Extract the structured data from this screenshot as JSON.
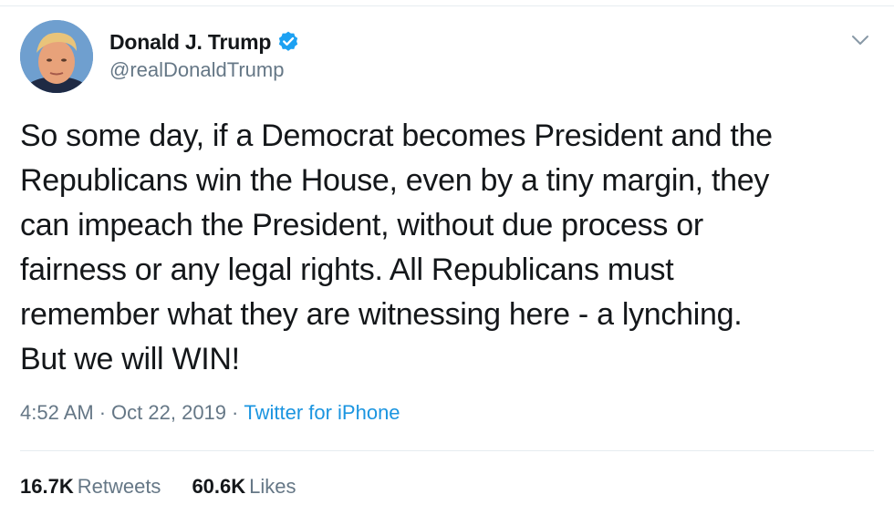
{
  "author": {
    "display_name": "Donald J. Trump",
    "handle": "@realDonaldTrump",
    "verified": true,
    "avatar_icon": "profile-photo"
  },
  "tweet": {
    "text_lines": [
      "So some day, if a Democrat becomes President and the",
      "Republicans win the House, even by a tiny margin, they",
      "can impeach the President, without due process or",
      "fairness or any legal rights. All Republicans must",
      "remember what they are witnessing here - a lynching.",
      "But we will WIN!"
    ]
  },
  "meta": {
    "time": "4:52 AM",
    "sep1": "·",
    "date": "Oct 22, 2019",
    "sep2": "·",
    "source": "Twitter for iPhone"
  },
  "stats": {
    "retweets_count": "16.7K",
    "retweets_label": "Retweets",
    "likes_count": "60.6K",
    "likes_label": "Likes"
  },
  "colors": {
    "text": "#14171a",
    "secondary": "#657786",
    "link": "#1b95e0",
    "verified": "#1da1f2",
    "divider": "#e6ecf0"
  }
}
